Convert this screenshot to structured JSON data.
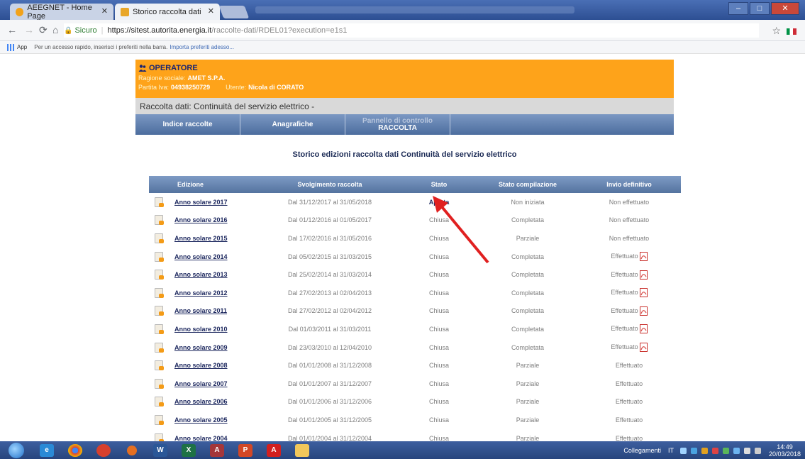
{
  "browser": {
    "tabs": [
      {
        "label": "AEEGNET - Home Page",
        "active": false
      },
      {
        "label": "Storico raccolta dati",
        "active": true
      }
    ],
    "url": {
      "secure_label": "Sicuro",
      "host": "https://sitest.autorita.energia.it",
      "path": "/raccolte-dati/RDEL01?execution=e1s1"
    },
    "bookmarks": {
      "apps_label": "App",
      "hint": "Per un accesso rapido, inserisci i preferiti nella barra.",
      "import_link": "Importa preferiti adesso..."
    }
  },
  "operator": {
    "title": "OPERATORE",
    "ragione_label": "Ragione sociale:",
    "ragione_value": "AMET S.P.A.",
    "piva_label": "Partita Iva:",
    "piva_value": "04938250729",
    "utente_label": "Utente:",
    "utente_value": "Nicola di CORATO"
  },
  "raccolta_label": "Raccolta dati: Continuità del servizio elettrico -",
  "menu": {
    "indice": "Indice raccolte",
    "anagrafiche": "Anagrafiche",
    "pannello_line1": "Pannello di controllo",
    "pannello_line2": "RACCOLTA"
  },
  "heading": "Storico edizioni raccolta dati Continuità del servizio elettrico",
  "table": {
    "headers": [
      "Edizione",
      "Svolgimento raccolta",
      "Stato",
      "Stato compilazione",
      "Invio definitivo"
    ],
    "rows": [
      {
        "edizione": "Anno solare 2017",
        "svolgimento": "Dal 31/12/2017 al 31/05/2018",
        "stato": "Aperta",
        "compilazione": "Non iniziata",
        "invio": "Non effettuato",
        "pdf": false
      },
      {
        "edizione": "Anno solare 2016",
        "svolgimento": "Dal 01/12/2016 al 01/05/2017",
        "stato": "Chiusa",
        "compilazione": "Completata",
        "invio": "Non effettuato",
        "pdf": false
      },
      {
        "edizione": "Anno solare 2015",
        "svolgimento": "Dal 17/02/2016 al 31/05/2016",
        "stato": "Chiusa",
        "compilazione": "Parziale",
        "invio": "Non effettuato",
        "pdf": false
      },
      {
        "edizione": "Anno solare 2014",
        "svolgimento": "Dal 05/02/2015 al 31/03/2015",
        "stato": "Chiusa",
        "compilazione": "Completata",
        "invio": "Effettuato",
        "pdf": true
      },
      {
        "edizione": "Anno solare 2013",
        "svolgimento": "Dal 25/02/2014 al 31/03/2014",
        "stato": "Chiusa",
        "compilazione": "Completata",
        "invio": "Effettuato",
        "pdf": true
      },
      {
        "edizione": "Anno solare 2012",
        "svolgimento": "Dal 27/02/2013 al 02/04/2013",
        "stato": "Chiusa",
        "compilazione": "Completata",
        "invio": "Effettuato",
        "pdf": true
      },
      {
        "edizione": "Anno solare 2011",
        "svolgimento": "Dal 27/02/2012 al 02/04/2012",
        "stato": "Chiusa",
        "compilazione": "Completata",
        "invio": "Effettuato",
        "pdf": true
      },
      {
        "edizione": "Anno solare 2010",
        "svolgimento": "Dal 01/03/2011 al 31/03/2011",
        "stato": "Chiusa",
        "compilazione": "Completata",
        "invio": "Effettuato",
        "pdf": true
      },
      {
        "edizione": "Anno solare 2009",
        "svolgimento": "Dal 23/03/2010 al 12/04/2010",
        "stato": "Chiusa",
        "compilazione": "Completata",
        "invio": "Effettuato",
        "pdf": true
      },
      {
        "edizione": "Anno solare 2008",
        "svolgimento": "Dal 01/01/2008 al 31/12/2008",
        "stato": "Chiusa",
        "compilazione": "Parziale",
        "invio": "Effettuato",
        "pdf": false
      },
      {
        "edizione": "Anno solare 2007",
        "svolgimento": "Dal 01/01/2007 al 31/12/2007",
        "stato": "Chiusa",
        "compilazione": "Parziale",
        "invio": "Effettuato",
        "pdf": false
      },
      {
        "edizione": "Anno solare 2006",
        "svolgimento": "Dal 01/01/2006 al 31/12/2006",
        "stato": "Chiusa",
        "compilazione": "Parziale",
        "invio": "Effettuato",
        "pdf": false
      },
      {
        "edizione": "Anno solare 2005",
        "svolgimento": "Dal 01/01/2005 al 31/12/2005",
        "stato": "Chiusa",
        "compilazione": "Parziale",
        "invio": "Effettuato",
        "pdf": false
      },
      {
        "edizione": "Anno solare 2004",
        "svolgimento": "Dal 01/01/2004 al 31/12/2004",
        "stato": "Chiusa",
        "compilazione": "Parziale",
        "invio": "Effettuato",
        "pdf": false
      }
    ]
  },
  "taskbar": {
    "tray_label": "Collegamenti",
    "lang": "IT",
    "time": "14:49",
    "date": "20/03/2018"
  },
  "colors": {
    "operator_bg": "#fea31a",
    "header_blue": "#54739f",
    "arrow": "#e02020"
  }
}
